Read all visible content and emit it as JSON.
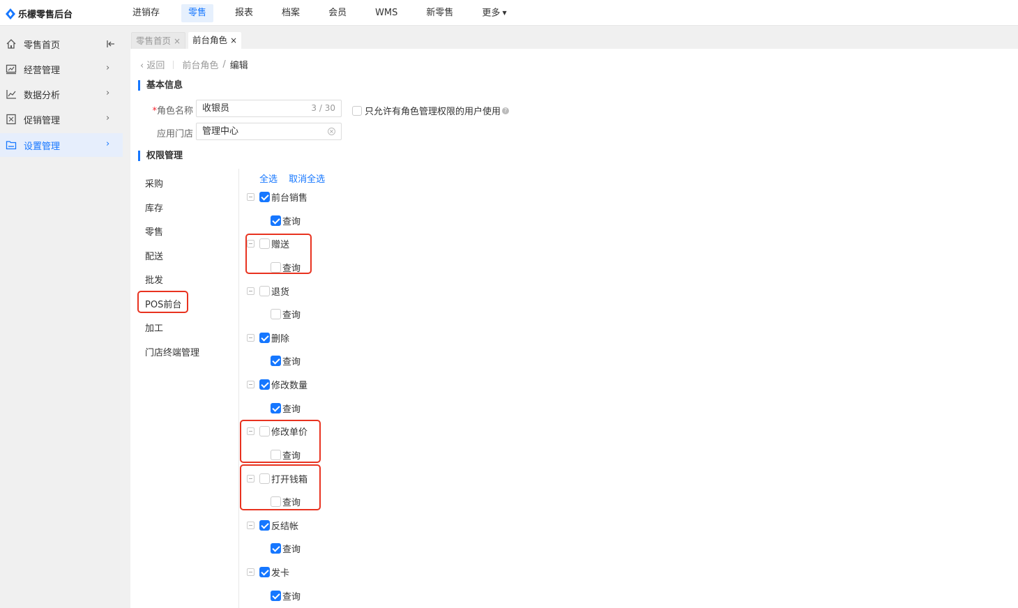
{
  "app": {
    "title": "乐檬零售后台"
  },
  "topnav": [
    {
      "label": "进销存",
      "active": false
    },
    {
      "label": "零售",
      "active": true
    },
    {
      "label": "报表",
      "active": false
    },
    {
      "label": "档案",
      "active": false
    },
    {
      "label": "会员",
      "active": false
    },
    {
      "label": "WMS",
      "active": false
    },
    {
      "label": "新零售",
      "active": false
    },
    {
      "label": "更多",
      "active": false
    }
  ],
  "sidebar": {
    "items": [
      {
        "label": "零售首页",
        "icon": "home-icon",
        "trailing": "collapse-icon"
      },
      {
        "label": "经营管理",
        "icon": "dashboard-icon",
        "trailing": "chevron-right-icon"
      },
      {
        "label": "数据分析",
        "icon": "line-chart-icon",
        "trailing": "chevron-right-icon"
      },
      {
        "label": "促销管理",
        "icon": "promotion-icon",
        "trailing": "chevron-right-icon"
      },
      {
        "label": "设置管理",
        "icon": "folder-icon",
        "trailing": "chevron-right-icon",
        "active": true
      }
    ]
  },
  "tabs": [
    {
      "label": "零售首页",
      "close": "×",
      "active": false
    },
    {
      "label": "前台角色",
      "close": "×",
      "active": true
    }
  ],
  "breadcrumb": {
    "back": "返回",
    "parent": "前台角色",
    "sep": "/",
    "current": "编辑"
  },
  "basic": {
    "section_title": "基本信息",
    "role_name_label": "角色名称",
    "role_name_required": "*",
    "role_name_value": "收银员",
    "role_name_count": "3 / 30",
    "store_label": "应用门店",
    "store_value": "管理中心",
    "only_option_label": "只允许有角色管理权限的用户使用",
    "help": "?"
  },
  "perm": {
    "section_title": "权限管理",
    "categories": [
      "采购",
      "库存",
      "零售",
      "配送",
      "批发",
      "POS前台",
      "加工",
      "门店终端管理"
    ],
    "selected_category": "POS前台",
    "select_all": "全选",
    "deselect_all": "取消全选",
    "groups": [
      {
        "label": "前台销售",
        "checked": true,
        "child": {
          "label": "查询",
          "checked": true
        }
      },
      {
        "label": "赠送",
        "checked": false,
        "child": {
          "label": "查询",
          "checked": false
        }
      },
      {
        "label": "退货",
        "checked": false,
        "child": {
          "label": "查询",
          "checked": false
        }
      },
      {
        "label": "删除",
        "checked": true,
        "child": {
          "label": "查询",
          "checked": true
        }
      },
      {
        "label": "修改数量",
        "checked": true,
        "child": {
          "label": "查询",
          "checked": true
        }
      },
      {
        "label": "修改单价",
        "checked": false,
        "child": {
          "label": "查询",
          "checked": false
        }
      },
      {
        "label": "打开钱箱",
        "checked": false,
        "child": {
          "label": "查询",
          "checked": false
        }
      },
      {
        "label": "反结帐",
        "checked": true,
        "child": {
          "label": "查询",
          "checked": true
        }
      },
      {
        "label": "发卡",
        "checked": true,
        "child": {
          "label": "查询",
          "checked": true
        }
      }
    ]
  },
  "colors": {
    "accent": "#1677ff",
    "highlight": "#e8321f"
  }
}
